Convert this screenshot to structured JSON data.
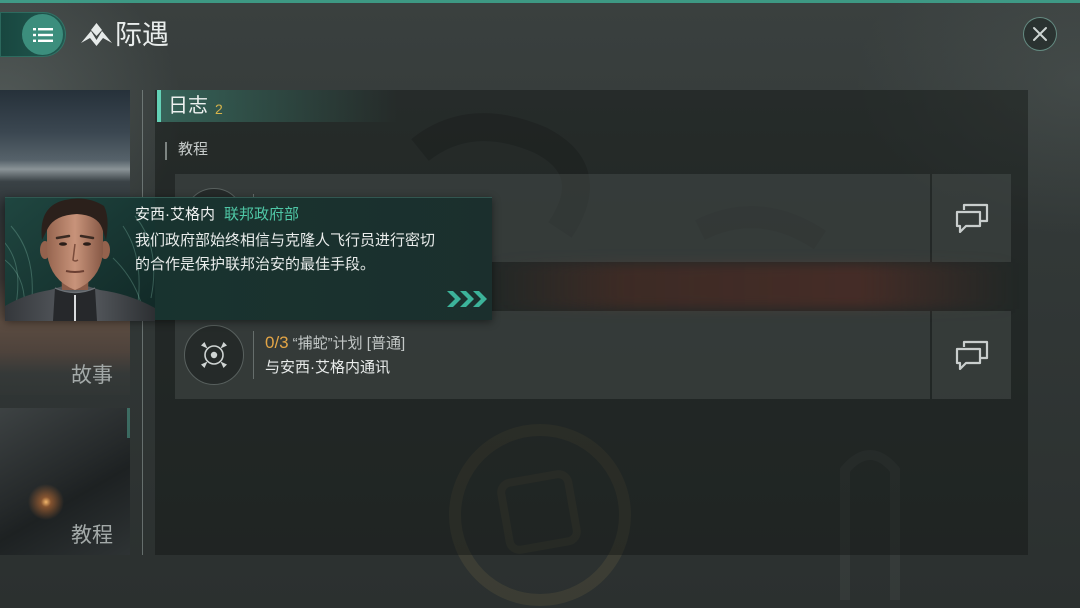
{
  "header": {
    "title": "际遇",
    "menu_icon": "menu-icon",
    "logo_icon": "encounter-logo-icon",
    "close_icon": "close-icon"
  },
  "sidebar": {
    "cards": [
      {
        "label": "故事"
      },
      {
        "label": "教程"
      }
    ]
  },
  "log": {
    "title": "日志",
    "count": "2",
    "section": "教程",
    "tasks": [
      {
        "icon": "target-icon",
        "action_icon": "chat-icon"
      },
      {
        "progress": "0/3",
        "title": "“捕蛇”计划 [普通]",
        "subtitle": "与安西·艾格内通讯",
        "icon": "target-icon",
        "action_icon": "chat-icon"
      }
    ]
  },
  "dialog": {
    "speaker": "安西·艾格内",
    "faction": "联邦政府部",
    "lines": [
      "我们政府部始终相信与克隆人飞行员进行密切",
      "的合作是保护联邦治安的最佳手段。"
    ],
    "next_icon": "triple-chevron-right-icon"
  },
  "colors": {
    "accent": "#3fb59b",
    "faction": "#4fc7a6",
    "count": "#d6b34b",
    "progress": "#e3a546"
  }
}
